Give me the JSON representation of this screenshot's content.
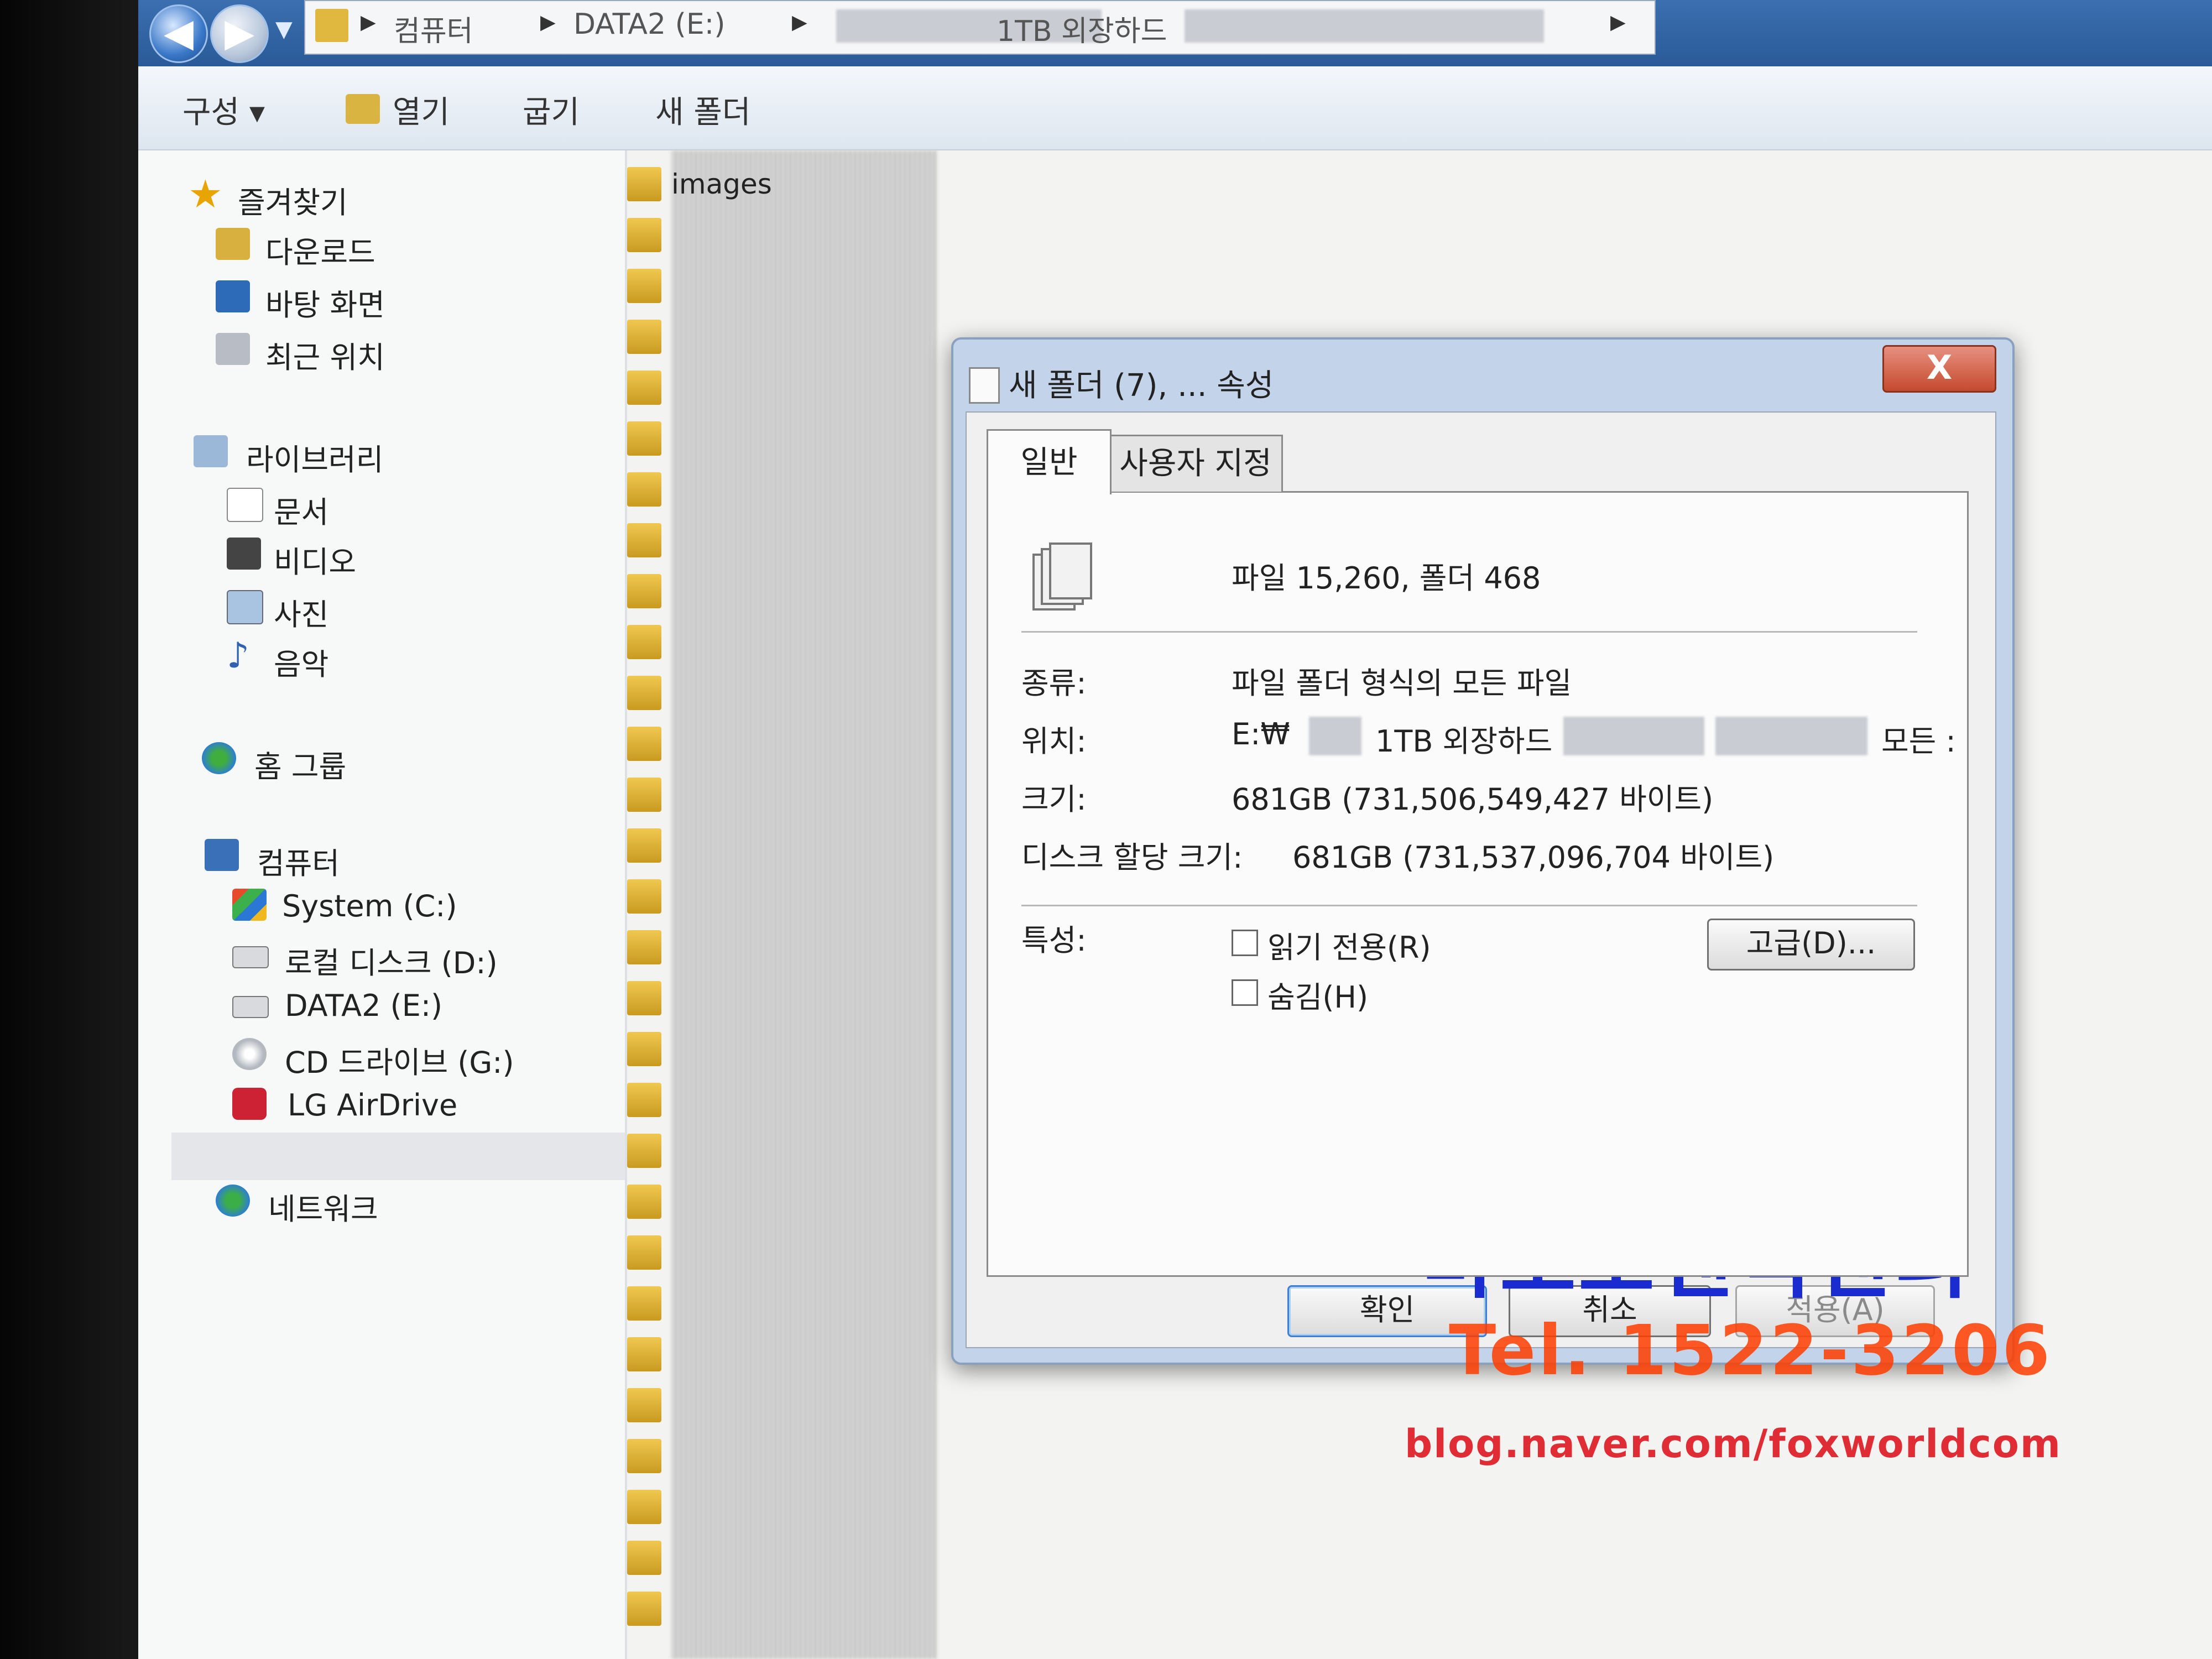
{
  "address_bar": {
    "crumbs": [
      "컴퓨터",
      "DATA2 (E:)",
      "1TB 외장하드"
    ]
  },
  "toolbar": {
    "organize": "구성 ▾",
    "open": "열기",
    "burn": "굽기",
    "new_folder": "새 폴더"
  },
  "nav": {
    "favorites": "즐겨찾기",
    "downloads": "다운로드",
    "desktop": "바탕 화면",
    "recent": "최근 위치",
    "libraries": "라이브러리",
    "documents": "문서",
    "videos": "비디오",
    "pictures": "사진",
    "music": "음악",
    "homegroup": "홈 그룹",
    "computer": "컴퓨터",
    "drive_c": "System (C:)",
    "drive_d": "로컬 디스크 (D:)",
    "drive_e": "DATA2 (E:)",
    "drive_g": "CD 드라이브 (G:)",
    "airdrive": "LG AirDrive",
    "network": "네트워크"
  },
  "filelist": {
    "first_item": "images"
  },
  "dialog": {
    "title": "새 폴더 (7), ... 속성",
    "close_glyph": "X",
    "tabs": [
      "일반",
      "사용자 지정"
    ],
    "summary": "파일 15,260, 폴더 468",
    "type_label": "종류:",
    "type_value": "파일 폴더 형식의 모든 파일",
    "location_label": "위치:",
    "location_value_prefix": "E:₩",
    "location_value_mid": "1TB 외장하드",
    "location_value_suffix": "모든 :",
    "size_label": "크기:",
    "size_value": "681GB (731,506,549,427 바이트)",
    "disk_size_label": "디스크 할당 크기:",
    "disk_size_value": "681GB (731,537,096,704 바이트)",
    "attributes_label": "특성:",
    "readonly_label": "읽기 전용(R)",
    "hidden_label": "숨김(H)",
    "advanced_button": "고급(D)...",
    "ok_button": "확인",
    "cancel_button": "취소",
    "apply_button": "적용(A)"
  },
  "watermark": {
    "title": "마포포렌식센터",
    "tel": "Tel. 1522-3206",
    "blog": "blog.naver.com/foxworldcom"
  }
}
